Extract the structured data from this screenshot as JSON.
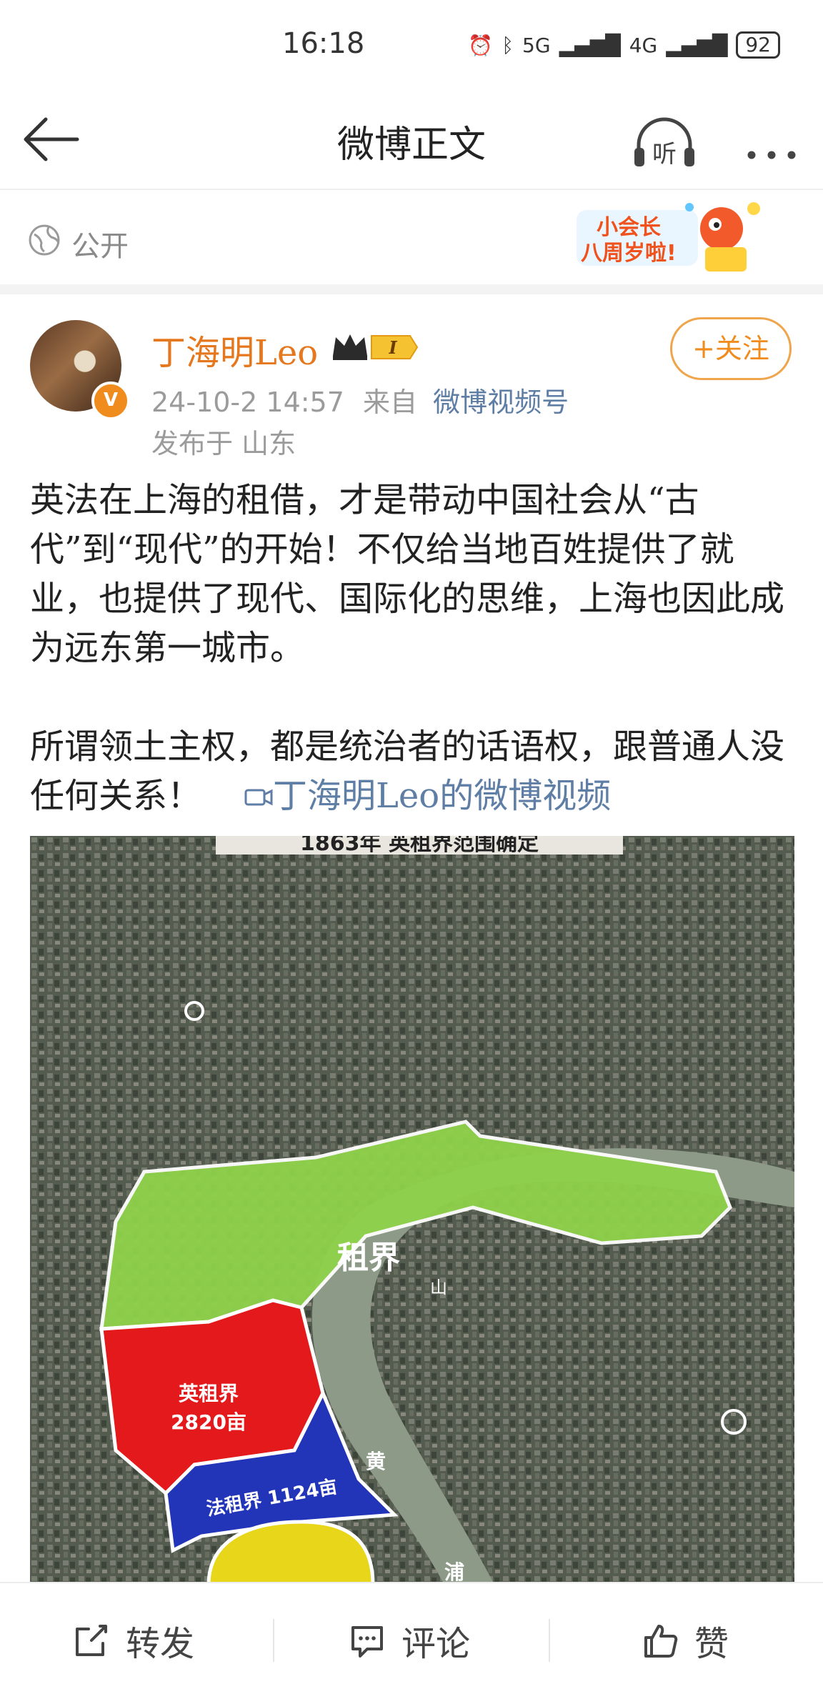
{
  "status_bar": {
    "time": "16:18",
    "network1": "5G",
    "network2": "4G",
    "battery": "92"
  },
  "nav": {
    "title": "微博正文",
    "listen_label": "听"
  },
  "visibility": {
    "label": "公开",
    "promo_line1": "小会长",
    "promo_line2": "八周岁啦!"
  },
  "author": {
    "name": "丁海明Leo",
    "member_level": "I",
    "follow_label": "+关注",
    "date": "24-10-2 14:57",
    "source_prefix": "来自",
    "source": "微博视频号",
    "location": "发布于 山东"
  },
  "post": {
    "paragraph1": "英法在上海的租借，才是带动中国社会从“古代”到“现代”的开始！不仅给当地百姓提供了就业，也提供了现代、国际化的思维，上海也因此成为远东第一城市。",
    "paragraph2": "所谓领土主权，都是统治者的话语权，跟普通人没任何关系！",
    "video_link": "丁海明Leo的微博视频"
  },
  "image": {
    "caption_partial": "1863年 英租界范围确定",
    "label_public": "租界",
    "label_british": "英租界",
    "label_british_area": "2820亩",
    "label_french": "法租界 1124亩",
    "label_river_1": "山",
    "label_river_2": "黄",
    "label_river_3": "浦",
    "colors": {
      "green": "#8fd24a",
      "red": "#e3191c",
      "blue": "#2234b8",
      "yellow": "#e8d61a",
      "river": "#8d9a88"
    }
  },
  "actions": {
    "repost": "转发",
    "comment": "评论",
    "like": "赞"
  }
}
